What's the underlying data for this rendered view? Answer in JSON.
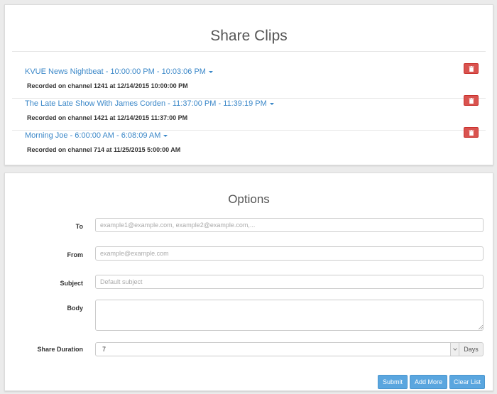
{
  "clips_panel": {
    "title": "Share Clips",
    "clips": [
      {
        "title": "KVUE News Nightbeat - 10:00:00 PM - 10:03:06 PM",
        "subtitle": "Recorded on channel 1241 at 12/14/2015 10:00:00 PM"
      },
      {
        "title": "The Late Late Show With James Corden - 11:37:00 PM - 11:39:19 PM",
        "subtitle": "Recorded on channel 1421 at 12/14/2015 11:37:00 PM"
      },
      {
        "title": "Morning Joe - 6:00:00 AM - 6:08:09 AM",
        "subtitle": "Recorded on channel 714 at 11/25/2015 5:00:00 AM"
      }
    ]
  },
  "options_panel": {
    "title": "Options",
    "to": {
      "label": "To",
      "value": "",
      "placeholder": "example1@example.com, example2@example.com,..."
    },
    "from": {
      "label": "From",
      "value": "",
      "placeholder": "example@example.com"
    },
    "subject": {
      "label": "Subject",
      "value": "",
      "placeholder": "Default subject"
    },
    "body": {
      "label": "Body",
      "value": ""
    },
    "share_duration": {
      "label": "Share Duration",
      "selected": "7",
      "addon": "Days"
    },
    "buttons": {
      "submit": "Submit",
      "add_more": "Add More",
      "clear_list": "Clear List"
    }
  },
  "colors": {
    "link": "#3a87c8",
    "danger": "#d9534f",
    "primary_button": "#5aa6df",
    "background": "#ebebeb"
  },
  "icons": {
    "delete": "trash-icon",
    "clip_menu": "caret-down-icon",
    "select": "chevron-down-icon"
  }
}
